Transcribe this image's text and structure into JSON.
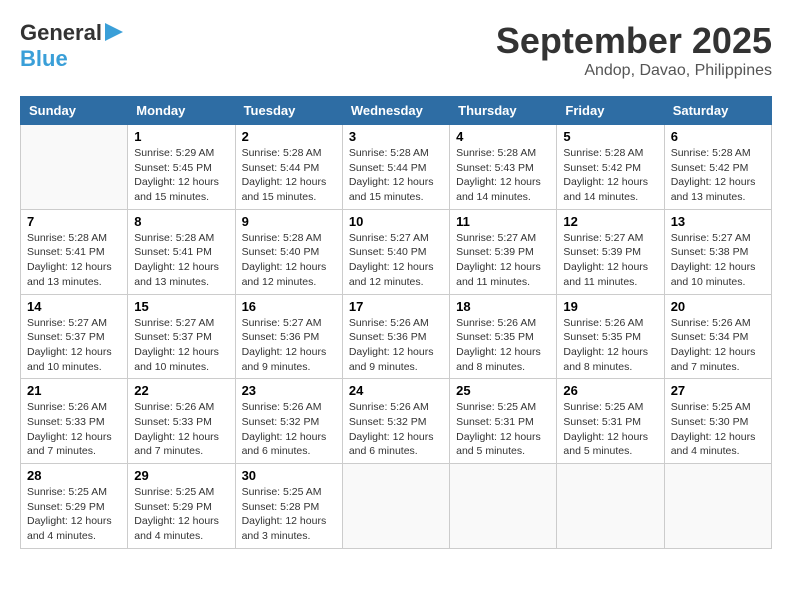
{
  "header": {
    "logo_line1": "General",
    "logo_line2": "Blue",
    "month": "September 2025",
    "location": "Andop, Davao, Philippines"
  },
  "days_of_week": [
    "Sunday",
    "Monday",
    "Tuesday",
    "Wednesday",
    "Thursday",
    "Friday",
    "Saturday"
  ],
  "weeks": [
    [
      null,
      {
        "date": 1,
        "sunrise": "5:29 AM",
        "sunset": "5:45 PM",
        "daylight": "12 hours and 15 minutes."
      },
      {
        "date": 2,
        "sunrise": "5:28 AM",
        "sunset": "5:44 PM",
        "daylight": "12 hours and 15 minutes."
      },
      {
        "date": 3,
        "sunrise": "5:28 AM",
        "sunset": "5:44 PM",
        "daylight": "12 hours and 15 minutes."
      },
      {
        "date": 4,
        "sunrise": "5:28 AM",
        "sunset": "5:43 PM",
        "daylight": "12 hours and 14 minutes."
      },
      {
        "date": 5,
        "sunrise": "5:28 AM",
        "sunset": "5:42 PM",
        "daylight": "12 hours and 14 minutes."
      },
      {
        "date": 6,
        "sunrise": "5:28 AM",
        "sunset": "5:42 PM",
        "daylight": "12 hours and 13 minutes."
      }
    ],
    [
      {
        "date": 7,
        "sunrise": "5:28 AM",
        "sunset": "5:41 PM",
        "daylight": "12 hours and 13 minutes."
      },
      {
        "date": 8,
        "sunrise": "5:28 AM",
        "sunset": "5:41 PM",
        "daylight": "12 hours and 13 minutes."
      },
      {
        "date": 9,
        "sunrise": "5:28 AM",
        "sunset": "5:40 PM",
        "daylight": "12 hours and 12 minutes."
      },
      {
        "date": 10,
        "sunrise": "5:27 AM",
        "sunset": "5:40 PM",
        "daylight": "12 hours and 12 minutes."
      },
      {
        "date": 11,
        "sunrise": "5:27 AM",
        "sunset": "5:39 PM",
        "daylight": "12 hours and 11 minutes."
      },
      {
        "date": 12,
        "sunrise": "5:27 AM",
        "sunset": "5:39 PM",
        "daylight": "12 hours and 11 minutes."
      },
      {
        "date": 13,
        "sunrise": "5:27 AM",
        "sunset": "5:38 PM",
        "daylight": "12 hours and 10 minutes."
      }
    ],
    [
      {
        "date": 14,
        "sunrise": "5:27 AM",
        "sunset": "5:37 PM",
        "daylight": "12 hours and 10 minutes."
      },
      {
        "date": 15,
        "sunrise": "5:27 AM",
        "sunset": "5:37 PM",
        "daylight": "12 hours and 10 minutes."
      },
      {
        "date": 16,
        "sunrise": "5:27 AM",
        "sunset": "5:36 PM",
        "daylight": "12 hours and 9 minutes."
      },
      {
        "date": 17,
        "sunrise": "5:26 AM",
        "sunset": "5:36 PM",
        "daylight": "12 hours and 9 minutes."
      },
      {
        "date": 18,
        "sunrise": "5:26 AM",
        "sunset": "5:35 PM",
        "daylight": "12 hours and 8 minutes."
      },
      {
        "date": 19,
        "sunrise": "5:26 AM",
        "sunset": "5:35 PM",
        "daylight": "12 hours and 8 minutes."
      },
      {
        "date": 20,
        "sunrise": "5:26 AM",
        "sunset": "5:34 PM",
        "daylight": "12 hours and 7 minutes."
      }
    ],
    [
      {
        "date": 21,
        "sunrise": "5:26 AM",
        "sunset": "5:33 PM",
        "daylight": "12 hours and 7 minutes."
      },
      {
        "date": 22,
        "sunrise": "5:26 AM",
        "sunset": "5:33 PM",
        "daylight": "12 hours and 7 minutes."
      },
      {
        "date": 23,
        "sunrise": "5:26 AM",
        "sunset": "5:32 PM",
        "daylight": "12 hours and 6 minutes."
      },
      {
        "date": 24,
        "sunrise": "5:26 AM",
        "sunset": "5:32 PM",
        "daylight": "12 hours and 6 minutes."
      },
      {
        "date": 25,
        "sunrise": "5:25 AM",
        "sunset": "5:31 PM",
        "daylight": "12 hours and 5 minutes."
      },
      {
        "date": 26,
        "sunrise": "5:25 AM",
        "sunset": "5:31 PM",
        "daylight": "12 hours and 5 minutes."
      },
      {
        "date": 27,
        "sunrise": "5:25 AM",
        "sunset": "5:30 PM",
        "daylight": "12 hours and 4 minutes."
      }
    ],
    [
      {
        "date": 28,
        "sunrise": "5:25 AM",
        "sunset": "5:29 PM",
        "daylight": "12 hours and 4 minutes."
      },
      {
        "date": 29,
        "sunrise": "5:25 AM",
        "sunset": "5:29 PM",
        "daylight": "12 hours and 4 minutes."
      },
      {
        "date": 30,
        "sunrise": "5:25 AM",
        "sunset": "5:28 PM",
        "daylight": "12 hours and 3 minutes."
      },
      null,
      null,
      null,
      null
    ]
  ]
}
